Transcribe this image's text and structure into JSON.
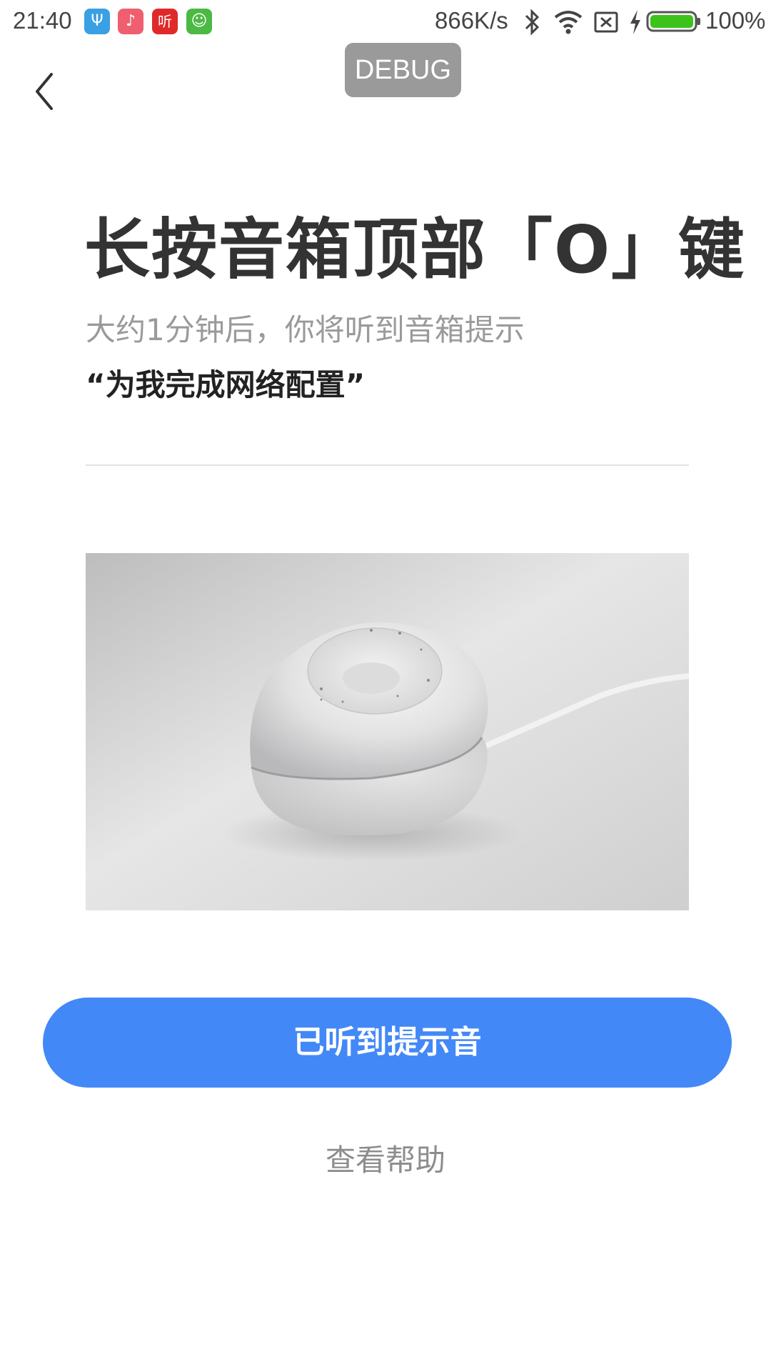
{
  "status_bar": {
    "time": "21:40",
    "apps": [
      {
        "icon": "usb-icon",
        "glyph": "Ψ",
        "color": "#3aa0e4"
      },
      {
        "icon": "music-app-icon",
        "glyph": "♪",
        "color": "#ef5f6f"
      },
      {
        "icon": "listen-app-icon",
        "glyph": "听",
        "color": "#e02a2a"
      },
      {
        "icon": "cat-app-icon",
        "glyph": "☺",
        "color": "#4cb944"
      }
    ],
    "net_speed": "866K/s",
    "battery_percent": "100%",
    "battery_color": "#3cc21a"
  },
  "debug_label": "DEBUG",
  "title": "长按音箱顶部「O」键",
  "subtitle": "大约1分钟后，你将听到音箱提示",
  "quote": "“为我完成网络配置”",
  "primary_button": {
    "label": "已听到提示音",
    "color": "#4388f7"
  },
  "help_link": "查看帮助"
}
